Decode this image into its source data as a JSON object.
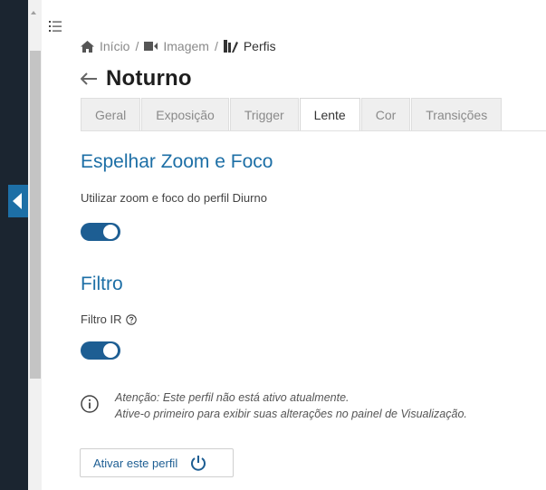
{
  "breadcrumb": {
    "items": [
      {
        "label": "Início",
        "icon": "home-icon"
      },
      {
        "label": "Imagem",
        "icon": "camera-icon"
      },
      {
        "label": "Perfis",
        "icon": "profiles-icon"
      }
    ],
    "separator": "/"
  },
  "page": {
    "title": "Noturno"
  },
  "tabs": [
    {
      "label": "Geral",
      "active": false
    },
    {
      "label": "Exposição",
      "active": false
    },
    {
      "label": "Trigger",
      "active": false
    },
    {
      "label": "Lente",
      "active": true
    },
    {
      "label": "Cor",
      "active": false
    },
    {
      "label": "Transições",
      "active": false
    }
  ],
  "mirror_section": {
    "title": "Espelhar Zoom e Foco",
    "toggle_label": "Utilizar zoom e foco do perfil Diurno",
    "toggle_on": true
  },
  "filter_section": {
    "title": "Filtro",
    "toggle_label": "Filtro IR",
    "toggle_on": true
  },
  "notice": {
    "line1": "Atenção: Este perfil não está ativo atualmente.",
    "line2": "Ative-o primeiro para exibir suas alterações no painel de Visualização."
  },
  "actions": {
    "activate_label": "Ativar este perfil"
  },
  "colors": {
    "accent": "#1d6fa6",
    "toggle": "#1d5e93",
    "sidebar": "#1b2530"
  }
}
